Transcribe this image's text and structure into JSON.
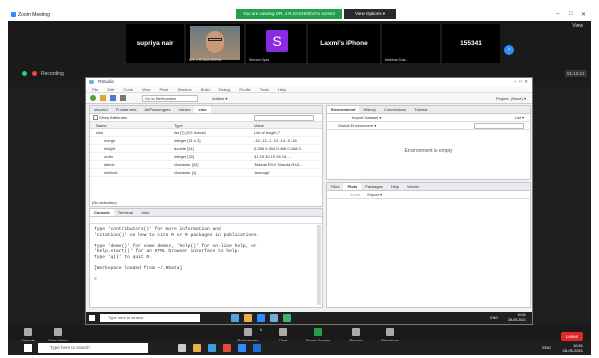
{
  "zoom": {
    "window_title": "Zoom Meeting",
    "viewing_banner": "You are viewing DR. J.R.SACHDEVA's screen",
    "view_options": "View Options ▾",
    "view_button": "View",
    "participants": [
      {
        "name": "supriya nair"
      },
      {
        "name": "DR. J.R.SACHDEVA"
      },
      {
        "name": "S",
        "caption": "Shivani Vyas"
      },
      {
        "name": "Laxmi's iPhone"
      },
      {
        "name": "",
        "caption": "Mahima Sola..."
      },
      {
        "name": "155341"
      }
    ],
    "recording_label": "Recording",
    "elapsed": "01:12:21",
    "controls": [
      "Unmute",
      "Start Video",
      "Participants",
      "Chat",
      "Share Screen",
      "Record",
      "Reactions"
    ],
    "leave": "Leave",
    "participant_count": "6"
  },
  "rstudio": {
    "title": "RStudio",
    "menu": [
      "File",
      "Edit",
      "Code",
      "View",
      "Plots",
      "Session",
      "Build",
      "Debug",
      "Profile",
      "Tools",
      "Help"
    ],
    "goto": "Go to file/function",
    "addins": "Addins ▾",
    "project": "Project: (None) ▾",
    "source_tabs": [
      "mtcars1",
      "R data sets",
      "AirPassengers",
      "mtcars",
      "clus"
    ],
    "show_attributes": "Show Attributes",
    "columns": [
      "Name",
      "Type",
      "Value"
    ],
    "rows": [
      {
        "name": "clus",
        "type": "list [7] (S3: hclust)",
        "value": "List of length 7"
      },
      {
        "name": "merge",
        "type": "integer [31 x 2]",
        "value": "-15 -12 -1 -10 -14 -5 -16"
      },
      {
        "name": "height",
        "type": "double [31]",
        "value": "0.286 0.394 0.408 0.408 0."
      },
      {
        "name": "order",
        "type": "integer [32]",
        "value": "31 29 30 19 26 18 ..."
      },
      {
        "name": "labels",
        "type": "character [32]",
        "value": "'Mazda RX4' 'Mazda RX4..."
      },
      {
        "name": "method",
        "type": "character [1]",
        "value": "'average'"
      }
    ],
    "no_selection": "(No selection)",
    "console_tabs": [
      "Console",
      "Terminal",
      "Jobs"
    ],
    "console_lines": [
      "Type 'contributors()' for more information and",
      "'citation()' on how to cite R or R packages in publications.",
      "",
      "Type 'demo()' for some demos, 'help()' for on-line help, or",
      "'help.start()' for an HTML browser interface to help.",
      "Type 'q()' to quit R.",
      "",
      "[Workspace loaded from ~/.RData]",
      "",
      ">"
    ],
    "env_tabs": [
      "Environment",
      "History",
      "Connections",
      "Tutorial"
    ],
    "import_dataset": "Import Dataset ▾",
    "list_view": "List ▾",
    "global_env": "Global Environment ▾",
    "env_empty": "Environment is empty",
    "files_tabs": [
      "Files",
      "Plots",
      "Packages",
      "Help",
      "Viewer"
    ],
    "zoom_btn": "Zoom",
    "export_btn": "Export ▾",
    "taskbar_search": "Type here to search",
    "clock_time": "10:51",
    "clock_date": "28-05-2021",
    "lang": "ENG"
  },
  "outer": {
    "taskbar_search": "Type here to search",
    "clock_time": "10:51",
    "clock_date": "28-05-2021",
    "lang": "ENG"
  }
}
